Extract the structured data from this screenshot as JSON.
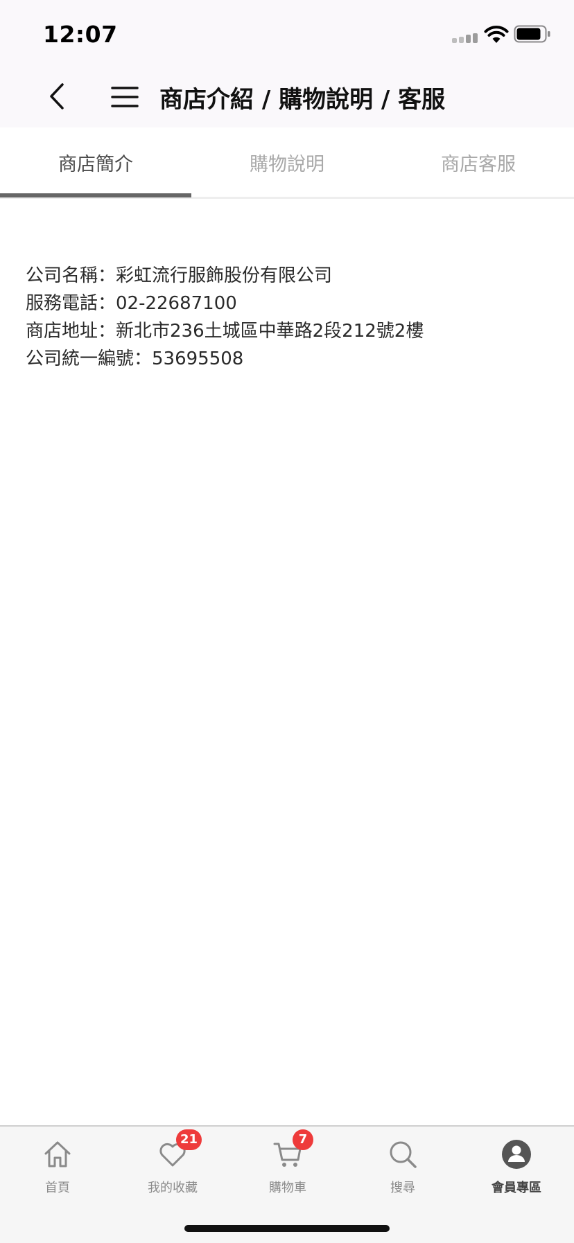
{
  "status_bar": {
    "time": "12:07",
    "signal_icon": "cellular-signal-icon",
    "wifi_icon": "wifi-icon",
    "battery_icon": "battery-icon"
  },
  "header": {
    "title": "商店介紹 / 購物說明 / 客服",
    "back_icon": "chevron-left-icon",
    "menu_icon": "hamburger-menu-icon"
  },
  "tabs": [
    {
      "label": "商店簡介",
      "active": true
    },
    {
      "label": "購物說明",
      "active": false
    },
    {
      "label": "商店客服",
      "active": false
    }
  ],
  "store_info": {
    "company_name": "公司名稱：彩虹流行服飾股份有限公司",
    "service_phone": "服務電話：02-22687100",
    "store_address": "商店地址：新北市236土城區中華路2段212號2樓",
    "tax_id": "公司統一編號：53695508"
  },
  "bottom_nav": [
    {
      "label": "首頁",
      "icon": "home-icon",
      "badge": null,
      "active": false
    },
    {
      "label": "我的收藏",
      "icon": "heart-icon",
      "badge": "21",
      "active": false
    },
    {
      "label": "購物車",
      "icon": "cart-icon",
      "badge": "7",
      "active": false
    },
    {
      "label": "搜尋",
      "icon": "search-icon",
      "badge": null,
      "active": false
    },
    {
      "label": "會員專區",
      "icon": "member-icon",
      "badge": null,
      "active": true
    }
  ],
  "colors": {
    "badge": "#ee3b3b",
    "active_tab_indicator": "#666666",
    "inactive_text": "#a9a9a9"
  }
}
